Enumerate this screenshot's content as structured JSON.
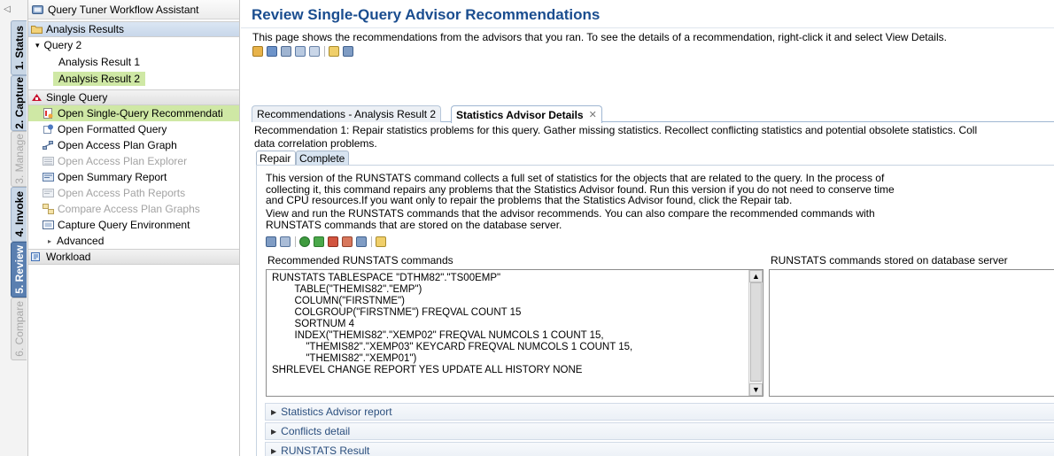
{
  "vertical_tabs": [
    {
      "label": "1. Status",
      "state": "enabled"
    },
    {
      "label": "2. Capture",
      "state": "enabled"
    },
    {
      "label": "3. Manage",
      "state": "disabled"
    },
    {
      "label": "4. Invoke",
      "state": "enabled"
    },
    {
      "label": "5. Review",
      "state": "active"
    },
    {
      "label": "6. Compare",
      "state": "disabled"
    }
  ],
  "nav": {
    "title": "Query Tuner Workflow Assistant",
    "analysis_results": "Analysis Results",
    "query_2": "Query 2",
    "analysis_result_1": "Analysis Result 1",
    "analysis_result_2": "Analysis Result 2",
    "single_query": "Single Query",
    "items": {
      "open_recommendations": "Open Single-Query Recommendati",
      "open_formatted": "Open Formatted Query",
      "open_access_plan_graph": "Open Access Plan Graph",
      "open_access_plan_explorer": "Open Access Plan Explorer",
      "open_summary_report": "Open Summary Report",
      "open_access_path_reports": "Open Access Path Reports",
      "compare_access_plan_graphs": "Compare Access Plan Graphs",
      "capture_query_environment": "Capture Query Environment",
      "advanced": "Advanced"
    },
    "workload": "Workload"
  },
  "main": {
    "title": "Review Single-Query Advisor Recommendations",
    "description": "This page shows the recommendations from the advisors that you ran. To see the details of a recommendation, right-click it and select View Details.",
    "tabs": {
      "recommendations": "Recommendations - Analysis Result 2",
      "details": "Statistics Advisor Details",
      "close_glyph": "✕"
    },
    "recommendation_line1": "Recommendation 1: Repair statistics problems for this query. Gather missing statistics. Recollect conflicting statistics and potential obsolete statistics. Coll",
    "recommendation_line2": "data correlation problems.",
    "subtabs": {
      "repair": "Repair",
      "complete": "Complete"
    },
    "para1": [
      "This version of the RUNSTATS command collects a full set of statistics for the objects that are related to the query. In the process of",
      "collecting it, this command repairs any problems that the Statistics Advisor found. Run this version if you do not need to conserve time",
      "and CPU resources.If you want only to repair the problems that the Statistics Advisor found, click the Repair tab."
    ],
    "para2": [
      "View and run the RUNSTATS commands that the advisor recommends. You can also compare the recommended commands with",
      "RUNSTATS commands that are stored on the database server."
    ],
    "recommended_label": "Recommended RUNSTATS commands",
    "stored_label": "RUNSTATS commands stored on database server",
    "commands": [
      "RUNSTATS TABLESPACE \"DTHM82\".\"TS00EMP\"",
      "        TABLE(\"THEMIS82\".\"EMP\")",
      "        COLUMN(\"FIRSTNME\")",
      "        COLGROUP(\"FIRSTNME\") FREQVAL COUNT 15",
      "        SORTNUM 4",
      "        INDEX(\"THEMIS82\".\"XEMP02\" FREQVAL NUMCOLS 1 COUNT 15,",
      "            \"THEMIS82\".\"XEMP03\" KEYCARD FREQVAL NUMCOLS 1 COUNT 15,",
      "            \"THEMIS82\".\"XEMP01\")",
      "SHRLEVEL CHANGE REPORT YES UPDATE ALL HISTORY NONE"
    ],
    "sections": [
      "Statistics Advisor report",
      "Conflicts detail",
      "RUNSTATS Result"
    ]
  },
  "icons": {
    "nav_title": "tuner-icon",
    "analysis_results": "folder-icon",
    "single_query": "db2-query-icon",
    "workload": "workload-icon"
  },
  "colors": {
    "title_blue": "#1a4d8f",
    "selected_green": "#cfe8a5",
    "active_tab": "#5a7fb0"
  }
}
